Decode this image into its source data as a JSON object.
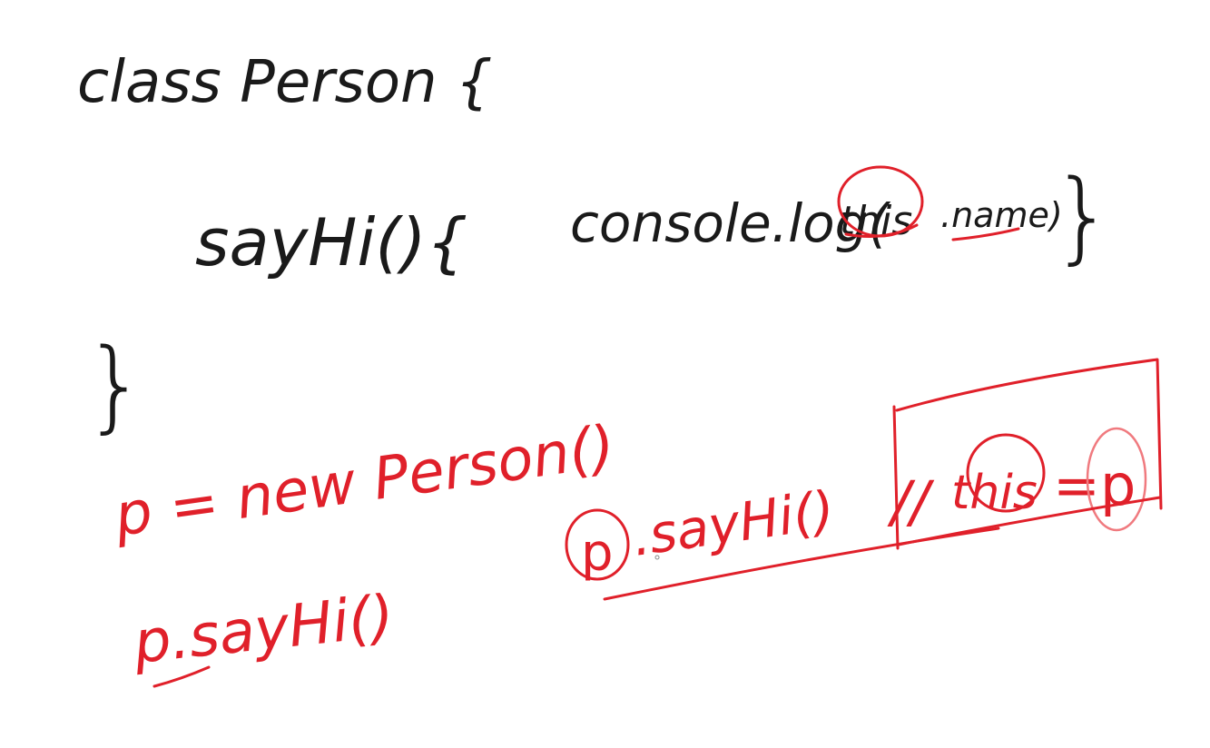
{
  "code_lines": {
    "class_decl": "class Person {",
    "method_sig": "sayHi(){",
    "method_body_prefix": "console.log(",
    "this_kw": "this",
    "method_body_suffix": ".name)",
    "method_close": "}",
    "class_close": "}"
  },
  "annotations": {
    "instantiate": "p = new Person()",
    "call_left": "p.sayHi()",
    "call_right_obj": "p",
    "call_right_method": ".sayHi()",
    "comment_prefix": "//",
    "comment_this": "this",
    "comment_suffix": "=p"
  },
  "colors": {
    "ink": "#1a1a1a",
    "red": "#e0202a",
    "background": "#ffffff"
  }
}
